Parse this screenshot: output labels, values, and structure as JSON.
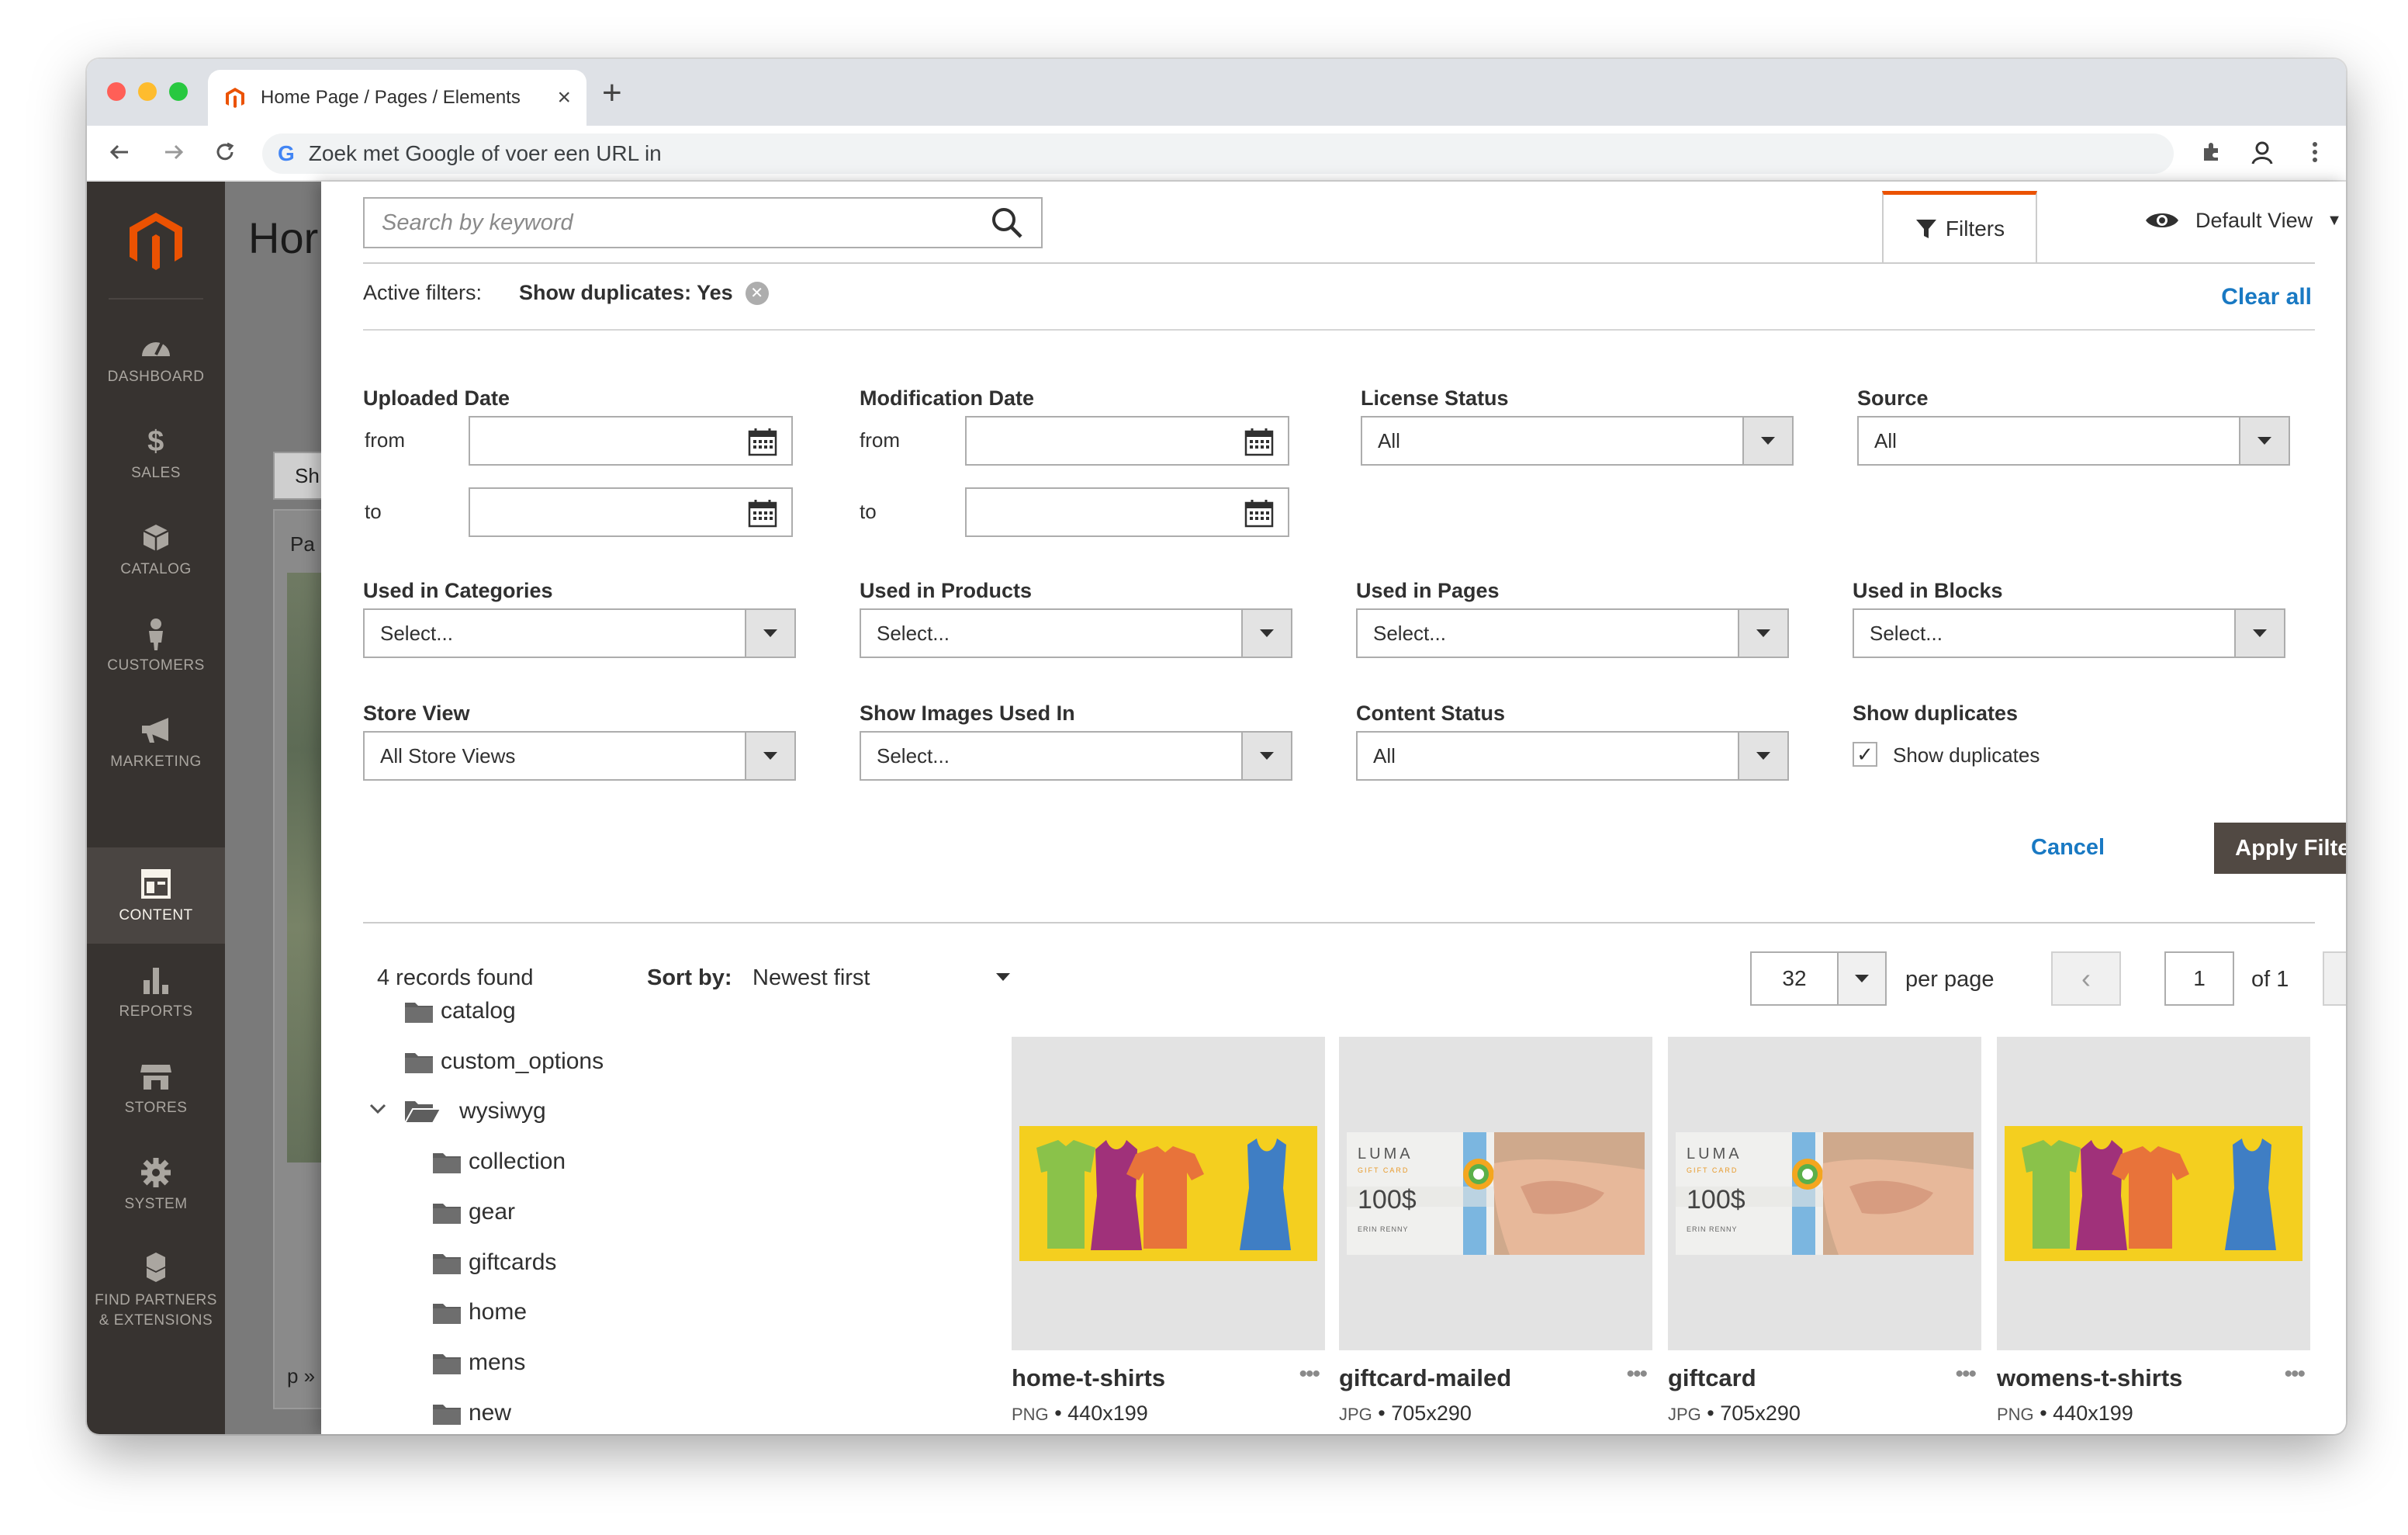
{
  "browser": {
    "tab_title": "Home Page / Pages / Elements",
    "tab_close": "×",
    "new_tab": "+",
    "address_placeholder": "Zoek met Google of voer een URL in",
    "google_glyph": "G"
  },
  "background_page": {
    "title": "Hor",
    "button_label": "Sh",
    "panel_label": "Pa",
    "footer_label": "p »"
  },
  "sidebar": {
    "items": [
      {
        "label": "DASHBOARD",
        "icon": "dashboard-icon"
      },
      {
        "label": "SALES",
        "icon": "dollar-icon"
      },
      {
        "label": "CATALOG",
        "icon": "cube-icon"
      },
      {
        "label": "CUSTOMERS",
        "icon": "person-icon"
      },
      {
        "label": "MARKETING",
        "icon": "megaphone-icon"
      },
      {
        "label": "CONTENT",
        "icon": "layout-icon",
        "active": true
      },
      {
        "label": "REPORTS",
        "icon": "bar-chart-icon"
      },
      {
        "label": "STORES",
        "icon": "storefront-icon"
      },
      {
        "label": "SYSTEM",
        "icon": "gear-icon"
      },
      {
        "label": "FIND PARTNERS & EXTENSIONS",
        "icon": "boxes-icon"
      }
    ]
  },
  "search": {
    "placeholder": "Search by keyword"
  },
  "toolbar": {
    "filters_label": "Filters",
    "view_label": "Default View"
  },
  "active_filters": {
    "label": "Active filters:",
    "value": "Show duplicates: Yes",
    "clear_all": "Clear all"
  },
  "filters": {
    "uploaded_date": {
      "label": "Uploaded Date",
      "from": "from",
      "to": "to"
    },
    "modification_date": {
      "label": "Modification Date",
      "from": "from",
      "to": "to"
    },
    "license_status": {
      "label": "License Status",
      "value": "All"
    },
    "source": {
      "label": "Source",
      "value": "All"
    },
    "used_in_categories": {
      "label": "Used in Categories",
      "value": "Select..."
    },
    "used_in_products": {
      "label": "Used in Products",
      "value": "Select..."
    },
    "used_in_pages": {
      "label": "Used in Pages",
      "value": "Select..."
    },
    "used_in_blocks": {
      "label": "Used in Blocks",
      "value": "Select..."
    },
    "store_view": {
      "label": "Store View",
      "value": "All Store Views"
    },
    "show_images_used_in": {
      "label": "Show Images Used In",
      "value": "Select..."
    },
    "content_status": {
      "label": "Content Status",
      "value": "All"
    },
    "show_duplicates": {
      "label": "Show duplicates",
      "checkbox_label": "Show duplicates",
      "checked": true,
      "checkmark": "✓"
    }
  },
  "actions": {
    "cancel": "Cancel",
    "apply": "Apply Filters"
  },
  "results": {
    "records_found": "4 records found",
    "sort_by_label": "Sort by:",
    "sort_value": "Newest first",
    "per_page_value": "32",
    "per_page_label": "per page",
    "prev": "‹",
    "next": "›",
    "page": "1",
    "page_of": "of 1"
  },
  "folders": [
    {
      "name": "catalog",
      "level": 0
    },
    {
      "name": "custom_options",
      "level": 0
    },
    {
      "name": "wysiwyg",
      "level": 0,
      "expanded": true
    },
    {
      "name": "collection",
      "level": 1
    },
    {
      "name": "gear",
      "level": 1
    },
    {
      "name": "giftcards",
      "level": 1
    },
    {
      "name": "home",
      "level": 1
    },
    {
      "name": "mens",
      "level": 1
    },
    {
      "name": "new",
      "level": 1
    }
  ],
  "images": [
    {
      "name": "home-t-shirts",
      "type": "PNG",
      "dims": "440x199",
      "kind": "tshirts"
    },
    {
      "name": "giftcard-mailed",
      "type": "JPG",
      "dims": "705x290",
      "kind": "giftcard"
    },
    {
      "name": "giftcard",
      "type": "JPG",
      "dims": "705x290",
      "kind": "giftcard"
    },
    {
      "name": "womens-t-shirts",
      "type": "PNG",
      "dims": "440x199",
      "kind": "tshirts"
    }
  ],
  "image_meta_separator": " • ",
  "more_glyph": "•••",
  "giftcard_art": {
    "brand": "LUMA",
    "subtitle": "GIFT CARD",
    "amount": "100$",
    "recipient": "ERIN RENNY"
  },
  "colors": {
    "accent_orange": "#eb5202",
    "link_blue": "#1979c3",
    "apply_bg": "#514943",
    "sidebar_bg": "#373330"
  }
}
